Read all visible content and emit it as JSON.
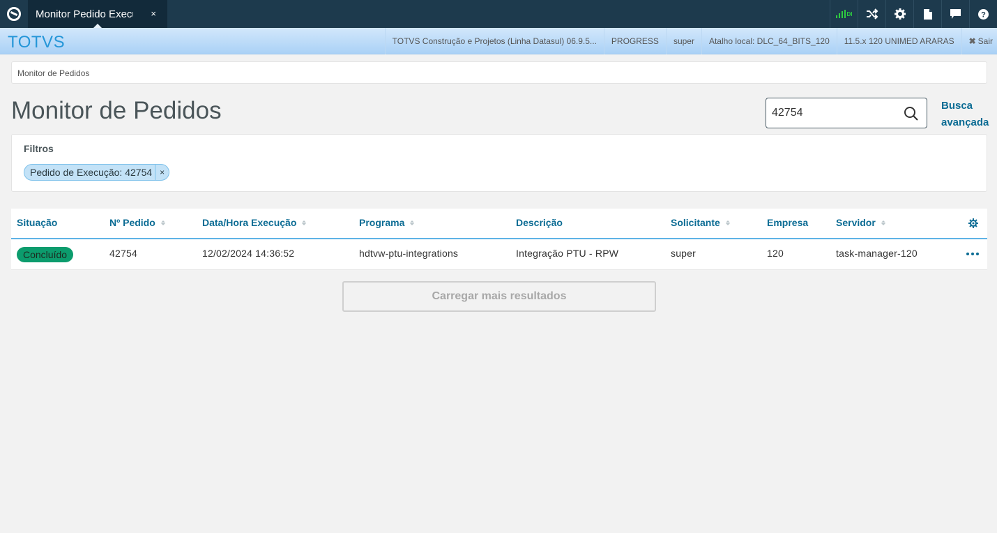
{
  "topbar": {
    "tab_title": "Monitor Pedido Execução",
    "tab_close": "×",
    "icons": [
      "shuffle-icon",
      "gear-icon",
      "document-icon",
      "chat-icon",
      "help-icon"
    ],
    "signal_label": "DI"
  },
  "infobar": {
    "brand": "TOTVS",
    "items": [
      "TOTVS Construção e Projetos (Linha Datasul) 06.9.5...",
      "PROGRESS",
      "super",
      "Atalho local: DLC_64_BITS_120",
      "11.5.x 120 UNIMED ARARAS"
    ],
    "sair": "Sair"
  },
  "breadcrumb": "Monitor de Pedidos",
  "page_title": "Monitor de Pedidos",
  "search": {
    "value": "42754",
    "busca": "Busca avançada"
  },
  "filters": {
    "label": "Filtros",
    "chip": "Pedido de Execução: 42754",
    "chip_close": "×"
  },
  "table": {
    "headers": {
      "situacao": "Situação",
      "pedido": "Nº Pedido",
      "data": "Data/Hora Execução",
      "programa": "Programa",
      "descricao": "Descrição",
      "solicitante": "Solicitante",
      "empresa": "Empresa",
      "servidor": "Servidor"
    },
    "rows": [
      {
        "situacao": "Concluído",
        "pedido": "42754",
        "data": "12/02/2024 14:36:52",
        "programa": "hdtvw-ptu-integrations",
        "descricao": "Integração PTU - RPW",
        "solicitante": "super",
        "empresa": "120",
        "servidor": "task-manager-120"
      }
    ]
  },
  "load_more": "Carregar mais resultados",
  "colors": {
    "accent": "#0c6c94",
    "status_success": "#0c9c6d",
    "topbar": "#1d3a4d",
    "brand": "#2596d8"
  }
}
